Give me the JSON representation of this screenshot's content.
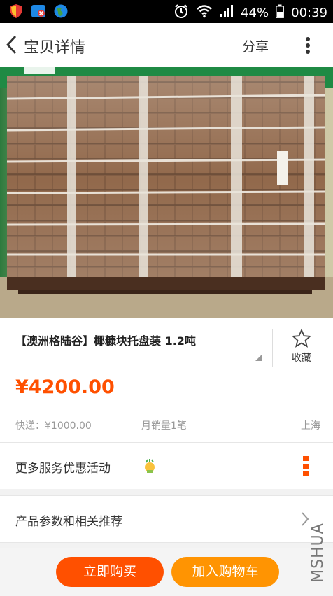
{
  "status_bar": {
    "battery": "44%",
    "time": "00:39"
  },
  "nav": {
    "title": "宝贝详情",
    "share": "分享"
  },
  "product": {
    "title": "【澳洲格陆谷】椰糠块托盘装 1.2吨",
    "favorite_label": "收藏",
    "price": "¥4200.00",
    "shipping": "快递：¥1000.00",
    "monthly_sales": "月销量1笔",
    "location": "上海"
  },
  "rows": {
    "services": "更多服务优惠活动",
    "params": "产品参数和相关推荐"
  },
  "actions": {
    "buy_now": "立即购买",
    "add_cart": "加入购物车"
  },
  "watermark": "MSHUA",
  "colors": {
    "accent": "#ff5000",
    "buy_btn": "#ff5000",
    "cart_btn": "#ff9402"
  }
}
